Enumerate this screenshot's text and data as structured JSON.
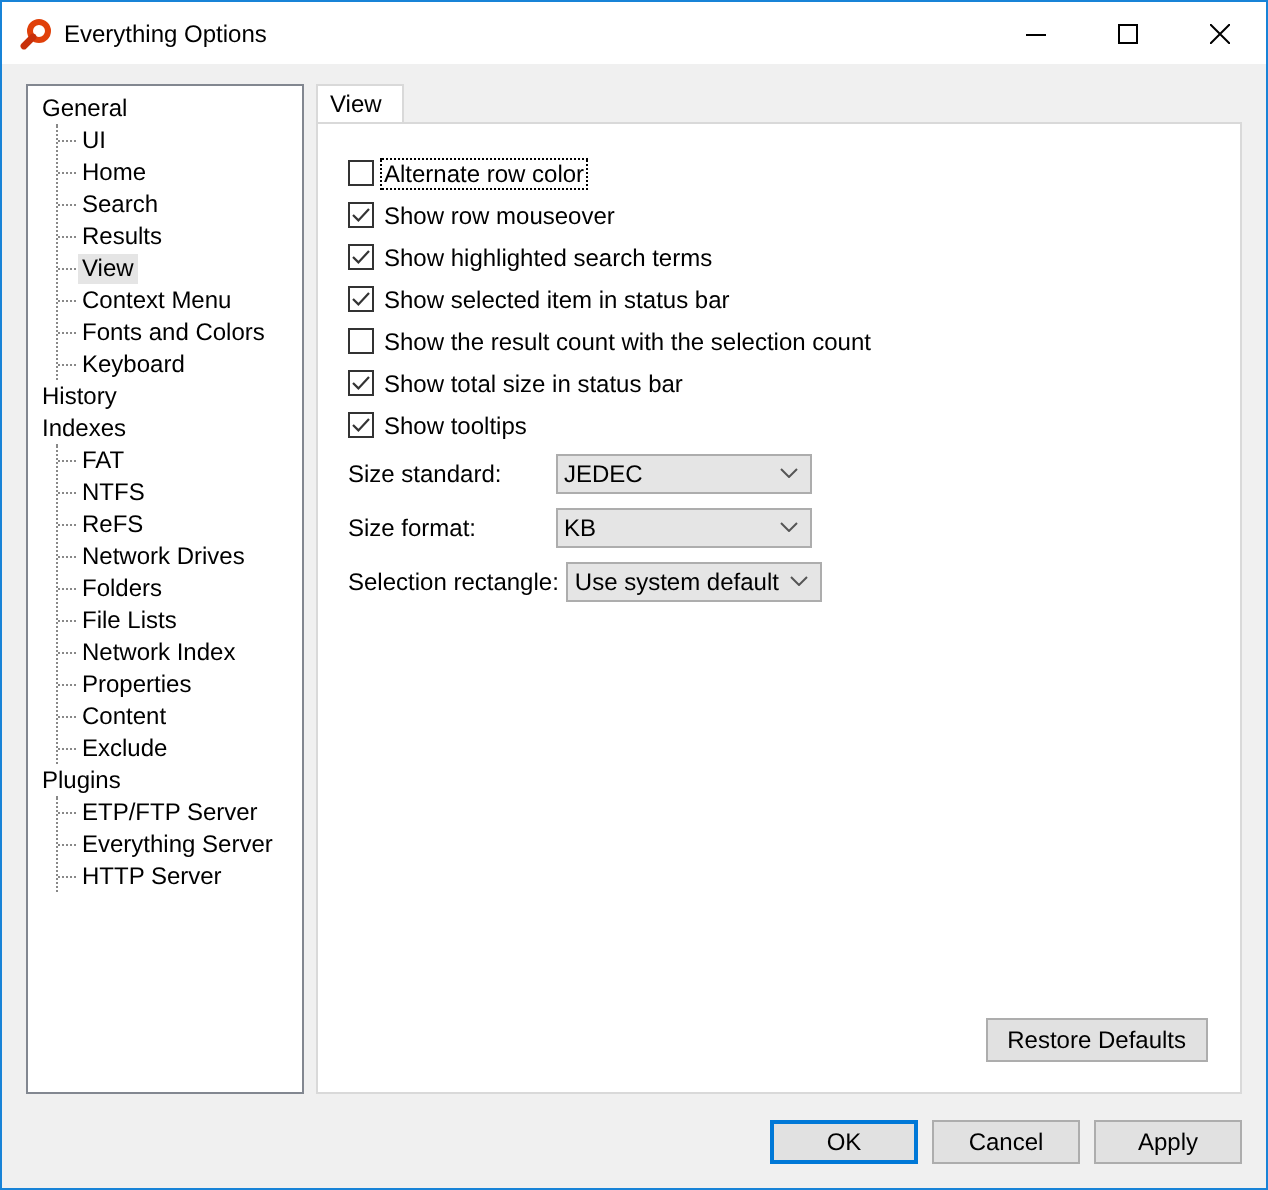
{
  "window": {
    "title": "Everything Options"
  },
  "tree": [
    {
      "label": "General",
      "selected": false,
      "children": [
        {
          "label": "UI",
          "selected": false
        },
        {
          "label": "Home",
          "selected": false
        },
        {
          "label": "Search",
          "selected": false
        },
        {
          "label": "Results",
          "selected": false
        },
        {
          "label": "View",
          "selected": true
        },
        {
          "label": "Context Menu",
          "selected": false
        },
        {
          "label": "Fonts and Colors",
          "selected": false
        },
        {
          "label": "Keyboard",
          "selected": false
        }
      ]
    },
    {
      "label": "History",
      "selected": false
    },
    {
      "label": "Indexes",
      "selected": false,
      "children": [
        {
          "label": "FAT",
          "selected": false
        },
        {
          "label": "NTFS",
          "selected": false
        },
        {
          "label": "ReFS",
          "selected": false
        },
        {
          "label": "Network Drives",
          "selected": false
        },
        {
          "label": "Folders",
          "selected": false
        },
        {
          "label": "File Lists",
          "selected": false
        },
        {
          "label": "Network Index",
          "selected": false
        },
        {
          "label": "Properties",
          "selected": false
        },
        {
          "label": "Content",
          "selected": false
        },
        {
          "label": "Exclude",
          "selected": false
        }
      ]
    },
    {
      "label": "Plugins",
      "selected": false,
      "children": [
        {
          "label": "ETP/FTP Server",
          "selected": false
        },
        {
          "label": "Everything Server",
          "selected": false
        },
        {
          "label": "HTTP Server",
          "selected": false
        }
      ]
    }
  ],
  "tabs": [
    {
      "label": "View",
      "selected": true
    }
  ],
  "options": [
    {
      "label": "Alternate row color",
      "checked": false,
      "focused": true
    },
    {
      "label": "Show row mouseover",
      "checked": true,
      "focused": false
    },
    {
      "label": "Show highlighted search terms",
      "checked": true,
      "focused": false
    },
    {
      "label": "Show selected item in status bar",
      "checked": true,
      "focused": false
    },
    {
      "label": "Show the result count with the selection count",
      "checked": false,
      "focused": false
    },
    {
      "label": "Show total size in status bar",
      "checked": true,
      "focused": false
    },
    {
      "label": "Show tooltips",
      "checked": true,
      "focused": false
    }
  ],
  "dropdowns": [
    {
      "label": "Size standard:",
      "value": "JEDEC"
    },
    {
      "label": "Size format:",
      "value": "KB"
    },
    {
      "label": "Selection rectangle:",
      "value": "Use system default"
    }
  ],
  "restore_button": "Restore Defaults",
  "buttons": [
    {
      "label": "OK",
      "default": true
    },
    {
      "label": "Cancel",
      "default": false
    },
    {
      "label": "Apply",
      "default": false
    }
  ]
}
